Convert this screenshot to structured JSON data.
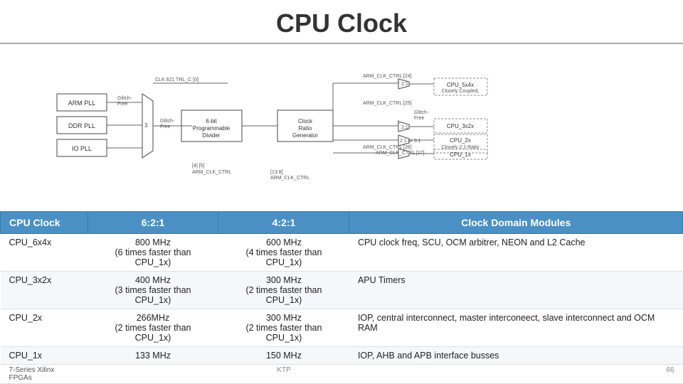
{
  "title": "CPU Clock",
  "table": {
    "headers": [
      "CPU Clock",
      "6:2:1",
      "4:2:1",
      "Clock Domain Modules"
    ],
    "rows": [
      {
        "name": "CPU_6x4x",
        "col2": "800 MHz\n(6 times faster than CPU_1x)",
        "col3": "600 MHz\n(4 times faster than CPU_1x)",
        "col4": "CPU clock freq, SCU, OCM arbitrer, NEON and L2 Cache"
      },
      {
        "name": "CPU_3x2x",
        "col2": "400 MHz\n(3 times faster than CPU_1x)",
        "col3": "300 MHz\n(2 times faster than CPU_1x)",
        "col4": "APU Timers"
      },
      {
        "name": "CPU_2x",
        "col2": "266MHz\n(2 times faster than CPU_1x)",
        "col3": "300 MHz\n(2 times faster than CPU_1x)",
        "col4": "IOP, central interconnect, master interconeect, slave interconnect and OCM RAM"
      },
      {
        "name": "CPU_1x",
        "col2": "133 MHz",
        "col3": "150 MHz",
        "col4": "IOP, AHB and APB interface busses"
      }
    ],
    "footer": {
      "left": "7-Series Xilinx FPGAs",
      "center": "KTP",
      "right": "66"
    }
  }
}
